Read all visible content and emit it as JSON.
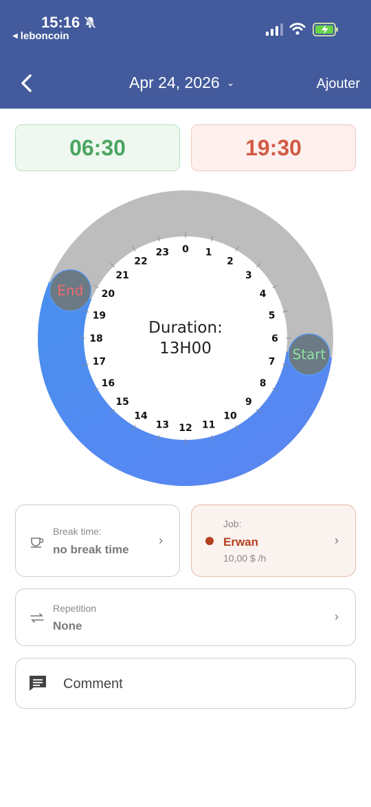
{
  "status_bar": {
    "time": "15:16",
    "back_app": "leboncoin"
  },
  "nav": {
    "date": "Apr 24, 2026",
    "add_label": "Ajouter"
  },
  "times": {
    "start": "06:30",
    "end": "19:30"
  },
  "dial": {
    "hours": [
      "0",
      "1",
      "2",
      "3",
      "4",
      "5",
      "6",
      "7",
      "8",
      "9",
      "10",
      "11",
      "12",
      "13",
      "14",
      "15",
      "16",
      "17",
      "18",
      "19",
      "20",
      "21",
      "22",
      "23"
    ],
    "start_hour": 6.5,
    "end_hour": 19.5,
    "duration_label": "Duration:",
    "duration_value": "13H00",
    "start_handle_label": "Start",
    "end_handle_label": "End",
    "colors": {
      "active": "#4f88ee",
      "inactive": "#bdbdbd",
      "handle": "#6b7a85",
      "start_text": "#8fe0a0",
      "end_text": "#f06a6a"
    }
  },
  "break": {
    "label": "Break time:",
    "value": "no break time",
    "icon": "cup-icon"
  },
  "job": {
    "label": "Job:",
    "name": "Erwan",
    "rate": "10,00 $ /h",
    "color": "#b3401f"
  },
  "repetition": {
    "label": "Repetition",
    "value": "None",
    "icon": "repeat-icon"
  },
  "comment": {
    "label": "Comment",
    "icon": "comment-icon"
  }
}
